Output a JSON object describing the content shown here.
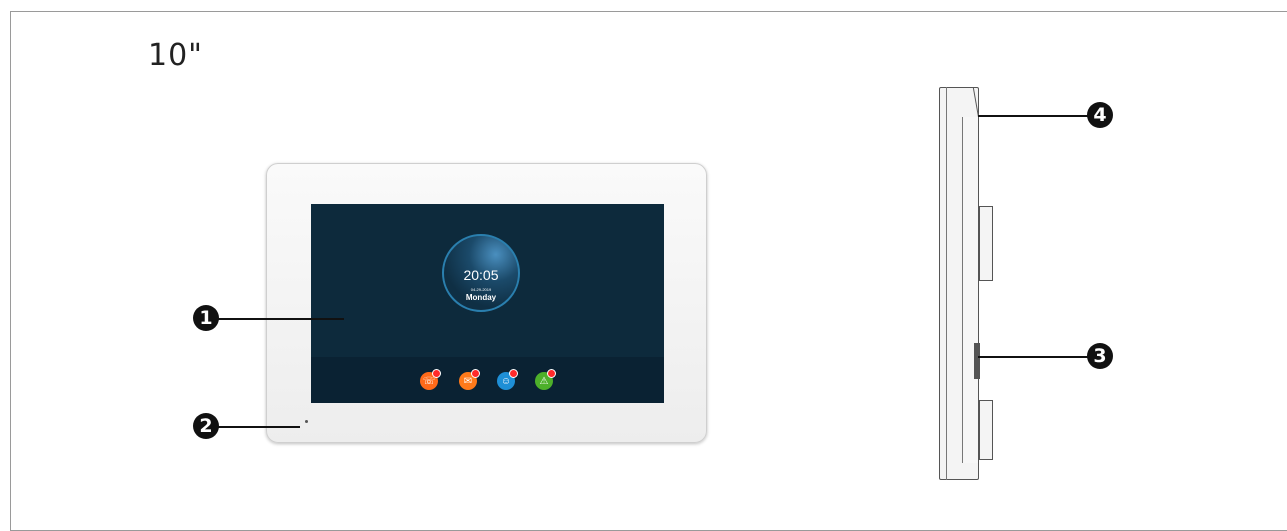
{
  "figure": {
    "size_label": "10\"",
    "callouts": [
      "1",
      "2",
      "3",
      "4"
    ]
  },
  "screen": {
    "time": "20:05",
    "date": "04-29-2019",
    "day": "Monday"
  },
  "apps": [
    {
      "icon": "phone-call-icon",
      "color": "#ff6a1a",
      "glyph": "☏"
    },
    {
      "icon": "message-icon",
      "color": "#ff7a1a",
      "glyph": "✉"
    },
    {
      "icon": "person-icon",
      "color": "#1e8fd6",
      "glyph": "☺"
    },
    {
      "icon": "alarm-icon",
      "color": "#4db02a",
      "glyph": "⚠"
    }
  ]
}
